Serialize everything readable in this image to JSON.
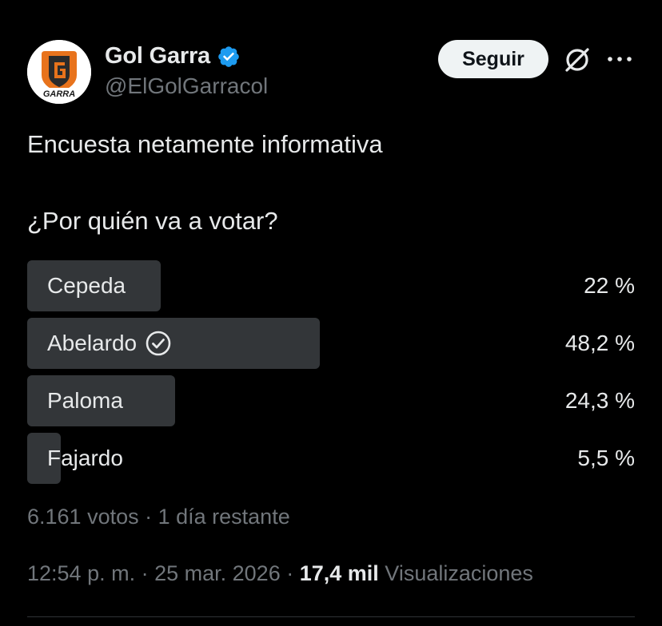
{
  "author": {
    "display_name": "Gol Garra",
    "handle": "@ElGolGarracol",
    "avatar_text": "GARRA",
    "verified": true
  },
  "actions": {
    "follow_label": "Seguir",
    "icons": [
      "grok-icon",
      "more-icon"
    ]
  },
  "tweet": {
    "text": "Encuesta netamente informativa"
  },
  "poll": {
    "question": "¿Por quién va a votar?",
    "options": [
      {
        "label": "Cepeda",
        "percent": "22 %",
        "share": 0.22,
        "winner": false
      },
      {
        "label": "Abelardo",
        "percent": "48,2 %",
        "share": 0.482,
        "winner": true
      },
      {
        "label": "Paloma",
        "percent": "24,3 %",
        "share": 0.243,
        "winner": false
      },
      {
        "label": "Fajardo",
        "percent": "5,5 %",
        "share": 0.055,
        "winner": false
      }
    ],
    "votes": "6.161 votos",
    "separator": " · ",
    "remaining": "1 día restante"
  },
  "meta": {
    "time": "12:54 p. m.",
    "separator": " · ",
    "date": "25 mar. 2026",
    "views_count": "17,4 mil",
    "views_label": "Visualizaciones"
  },
  "colors": {
    "background": "#000000",
    "text": "#e7e9ea",
    "muted": "#71767b",
    "bar": "#333639",
    "verified": "#1d9bf0",
    "avatar_orange": "#e8731c"
  }
}
